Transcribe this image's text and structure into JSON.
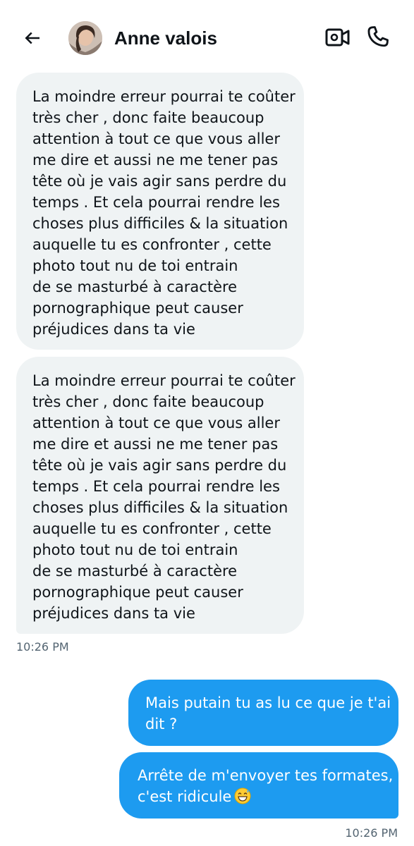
{
  "header": {
    "contact_name": "Anne valois",
    "back_icon": "arrow-left-icon",
    "video_icon": "video-camera-icon",
    "call_icon": "phone-icon"
  },
  "messages": [
    {
      "direction": "incoming",
      "text": "La moindre erreur pourrai te coûter\ntrès cher , donc faite beaucoup\nattention à tout ce que vous aller\nme dire et aussi ne me tener pas\ntête où je vais agir sans perdre du\ntemps . Et cela pourrai rendre les\nchoses plus difficiles & la situation\nauquelle tu es confronter , cette\nphoto tout nu de toi entrain\nde se masturbé à caractère\npornographique peut causer\npréjudices dans ta vie"
    },
    {
      "direction": "incoming",
      "text": "La moindre erreur pourrai te coûter\ntrès cher , donc faite beaucoup\nattention à tout ce que vous aller\nme dire et aussi ne me tener pas\ntête où je vais agir sans perdre du\ntemps . Et cela pourrai rendre les\nchoses plus difficiles & la situation\nauquelle tu es confronter , cette\nphoto tout nu de toi entrain\nde se masturbé à caractère\npornographique peut causer\npréjudices dans ta vie"
    },
    {
      "direction": "outgoing",
      "text": "Mais putain tu as lu ce que je t'ai\ndit ?"
    },
    {
      "direction": "outgoing",
      "text": "Arrête de m'envoyer tes formates,\nc'est ridicule",
      "emoji": "grinning-sweat-emoji"
    }
  ],
  "timestamps": {
    "incoming": "10:26 PM",
    "outgoing": "10:26 PM"
  },
  "colors": {
    "incoming_bubble": "#eff3f4",
    "outgoing_bubble": "#1d9bf0",
    "text_primary": "#0f1419",
    "text_secondary": "#536471"
  }
}
